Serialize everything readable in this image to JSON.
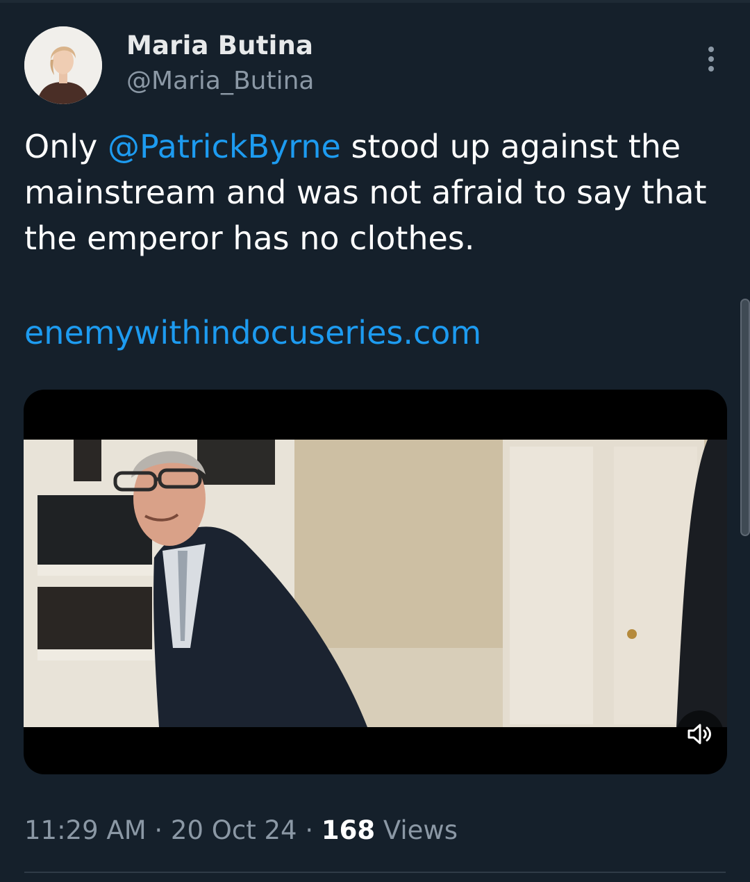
{
  "author": {
    "name": "Maria Butina",
    "handle": "@Maria_Butina"
  },
  "tweet": {
    "text_before": "Only ",
    "mention": "@PatrickByrne",
    "text_after": " stood up against the mainstream and was not afraid to say that the emperor has no clothes.",
    "link": "enemywithindocuseries.com"
  },
  "media": {
    "type": "video",
    "mute_icon": "volume-muted-icon"
  },
  "meta": {
    "time": "11:29 AM",
    "sep1": " · ",
    "date": "20 Oct 24",
    "sep2": " · ",
    "views_count": "168",
    "views_label": " Views"
  },
  "colors": {
    "background": "#15202b",
    "accent": "#1d9bf0",
    "secondary_text": "#8b98a5"
  }
}
